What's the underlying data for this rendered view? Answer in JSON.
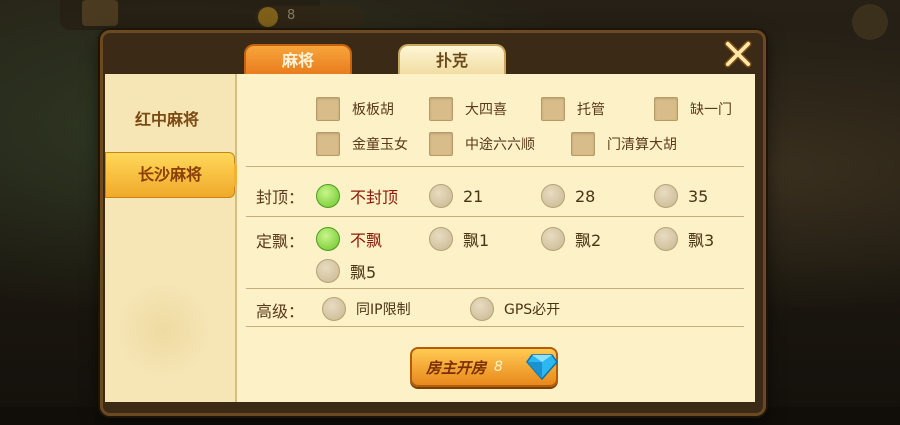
{
  "header": {
    "coin_count": "8"
  },
  "dialog": {
    "tabs": [
      {
        "label": "麻将",
        "active": true
      },
      {
        "label": "扑克",
        "active": false
      }
    ],
    "sidebar": {
      "items": [
        {
          "label": "红中麻将",
          "selected": false
        },
        {
          "label": "长沙麻将",
          "selected": true
        }
      ]
    },
    "options": {
      "checkboxes": [
        {
          "label": "板板胡"
        },
        {
          "label": "大四喜"
        },
        {
          "label": "托管"
        },
        {
          "label": "缺一门"
        },
        {
          "label": "金童玉女"
        },
        {
          "label": "中途六六顺"
        },
        {
          "label": "门清算大胡"
        }
      ]
    },
    "cap": {
      "label": "封顶：",
      "options": [
        {
          "label": "不封顶",
          "selected": true
        },
        {
          "label": "21",
          "selected": false
        },
        {
          "label": "28",
          "selected": false
        },
        {
          "label": "35",
          "selected": false
        }
      ]
    },
    "piao": {
      "label": "定飘：",
      "options": [
        {
          "label": "不飘",
          "selected": true
        },
        {
          "label": "飘1",
          "selected": false
        },
        {
          "label": "飘2",
          "selected": false
        },
        {
          "label": "飘3",
          "selected": false
        },
        {
          "label": "飘5",
          "selected": false
        }
      ]
    },
    "advanced": {
      "label": "高级：",
      "options": [
        {
          "label": "同IP限制",
          "selected": false
        },
        {
          "label": "GPS必开",
          "selected": false
        }
      ]
    },
    "create_button": {
      "label": "房主开房",
      "cost": "8"
    }
  },
  "colors": {
    "accent_orange": "#e87a1c",
    "selected_green": "#6bc52a",
    "panel_bg": "#fdf1c8"
  }
}
